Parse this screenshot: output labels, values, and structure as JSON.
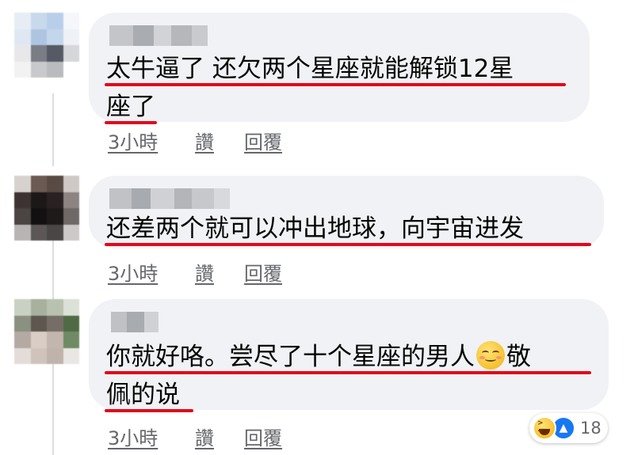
{
  "comments": [
    {
      "lines": [
        "太牛逼了 还欠两个星座就能解锁12星",
        "座了"
      ],
      "time": "3小時",
      "like": "讚",
      "reply": "回覆"
    },
    {
      "lines": [
        "还差两个就可以冲出地球，向宇宙进发"
      ],
      "time": "3小時",
      "like": "讚",
      "reply": "回覆"
    },
    {
      "lines": [
        "你就好咯。尝尽了十个星座的男人",
        "敬",
        "佩的说"
      ],
      "time": "3小時",
      "like": "讚",
      "reply": "回覆",
      "reactions": {
        "count": "18",
        "types": [
          "haha-icon",
          "like-icon"
        ]
      }
    }
  ],
  "colors": {
    "highlight": "#e0081c",
    "bubble": "#f0f2f5",
    "meta": "#65676b"
  }
}
